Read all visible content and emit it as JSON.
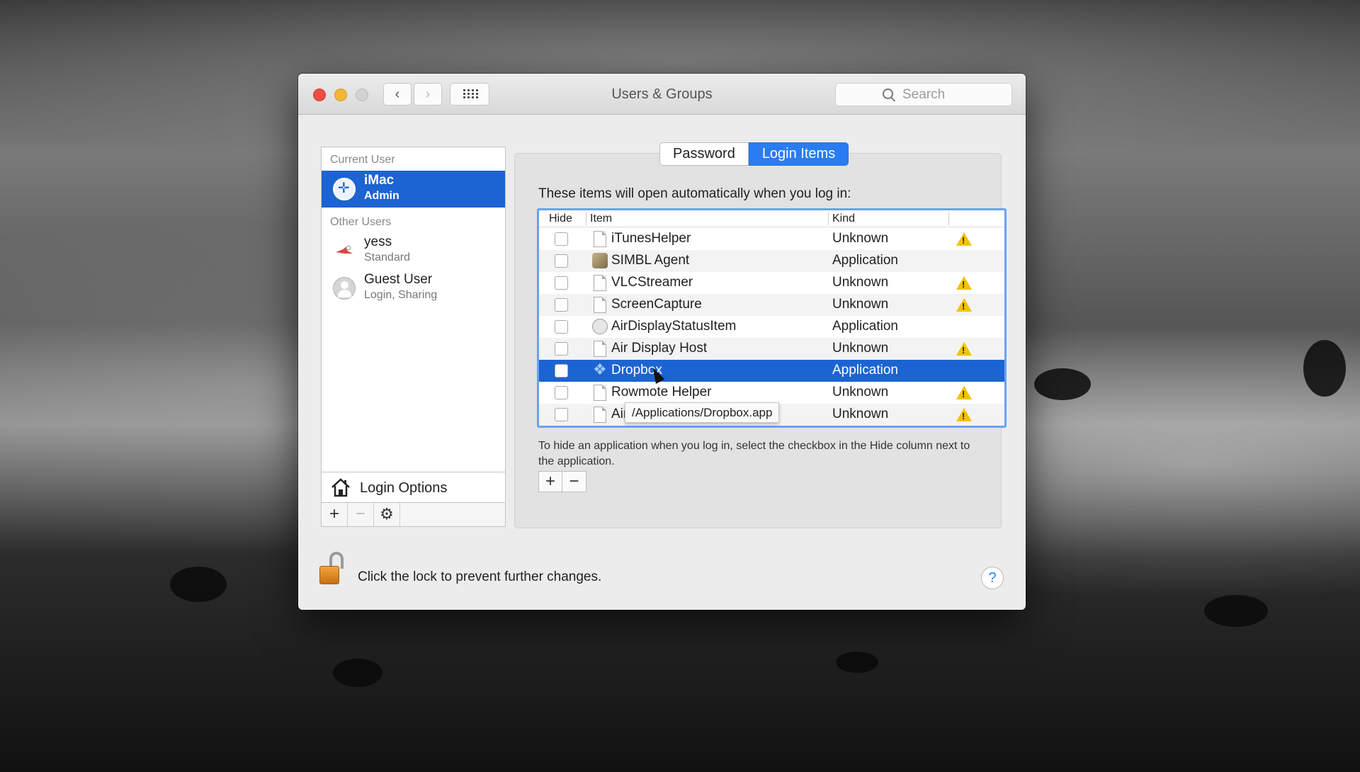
{
  "window": {
    "title": "Users & Groups"
  },
  "search": {
    "placeholder": "Search"
  },
  "sidebar": {
    "current_user_label": "Current User",
    "other_users_label": "Other Users",
    "users": [
      {
        "name": "iMac",
        "role": "Admin"
      },
      {
        "name": "yess",
        "role": "Standard"
      },
      {
        "name": "Guest User",
        "role": "Login, Sharing"
      }
    ],
    "login_options": "Login Options"
  },
  "tabs": {
    "password": "Password",
    "login_items": "Login Items"
  },
  "login_items": {
    "intro": "These items will open automatically when you log in:",
    "columns": {
      "hide": "Hide",
      "item": "Item",
      "kind": "Kind"
    },
    "rows": [
      {
        "name": "iTunesHelper",
        "kind": "Unknown",
        "warning": true,
        "icon": "document-icon"
      },
      {
        "name": "SIMBL Agent",
        "kind": "Application",
        "warning": false,
        "icon": "simbl-app-icon"
      },
      {
        "name": "VLCStreamer",
        "kind": "Unknown",
        "warning": true,
        "icon": "document-icon"
      },
      {
        "name": "ScreenCapture",
        "kind": "Unknown",
        "warning": true,
        "icon": "document-icon"
      },
      {
        "name": "AirDisplayStatusItem",
        "kind": "Application",
        "warning": false,
        "icon": "air-display-app-icon"
      },
      {
        "name": "Air Display Host",
        "kind": "Unknown",
        "warning": true,
        "icon": "document-icon"
      },
      {
        "name": "Dropbox",
        "kind": "Application",
        "warning": false,
        "icon": "dropbox-icon",
        "selected": true
      },
      {
        "name": "Rowmote Helper",
        "kind": "Unknown",
        "warning": true,
        "icon": "document-icon"
      },
      {
        "name": "Air",
        "kind": "Unknown",
        "warning": true,
        "icon": "document-icon"
      }
    ],
    "tooltip": "/Applications/Dropbox.app",
    "hint": "To hide an application when you log in, select the checkbox in the Hide column next to the application.",
    "add_label": "+",
    "remove_label": "−"
  },
  "sidebar_toolbar": {
    "add_label": "+",
    "remove_label": "−",
    "gear_label": "⚙"
  },
  "lock": {
    "text": "Click the lock to prevent further changes."
  },
  "help": {
    "label": "?"
  },
  "colors": {
    "selection": "#1c64d1",
    "tab_active": "#2a7cf2",
    "warning": "#f2c200"
  }
}
